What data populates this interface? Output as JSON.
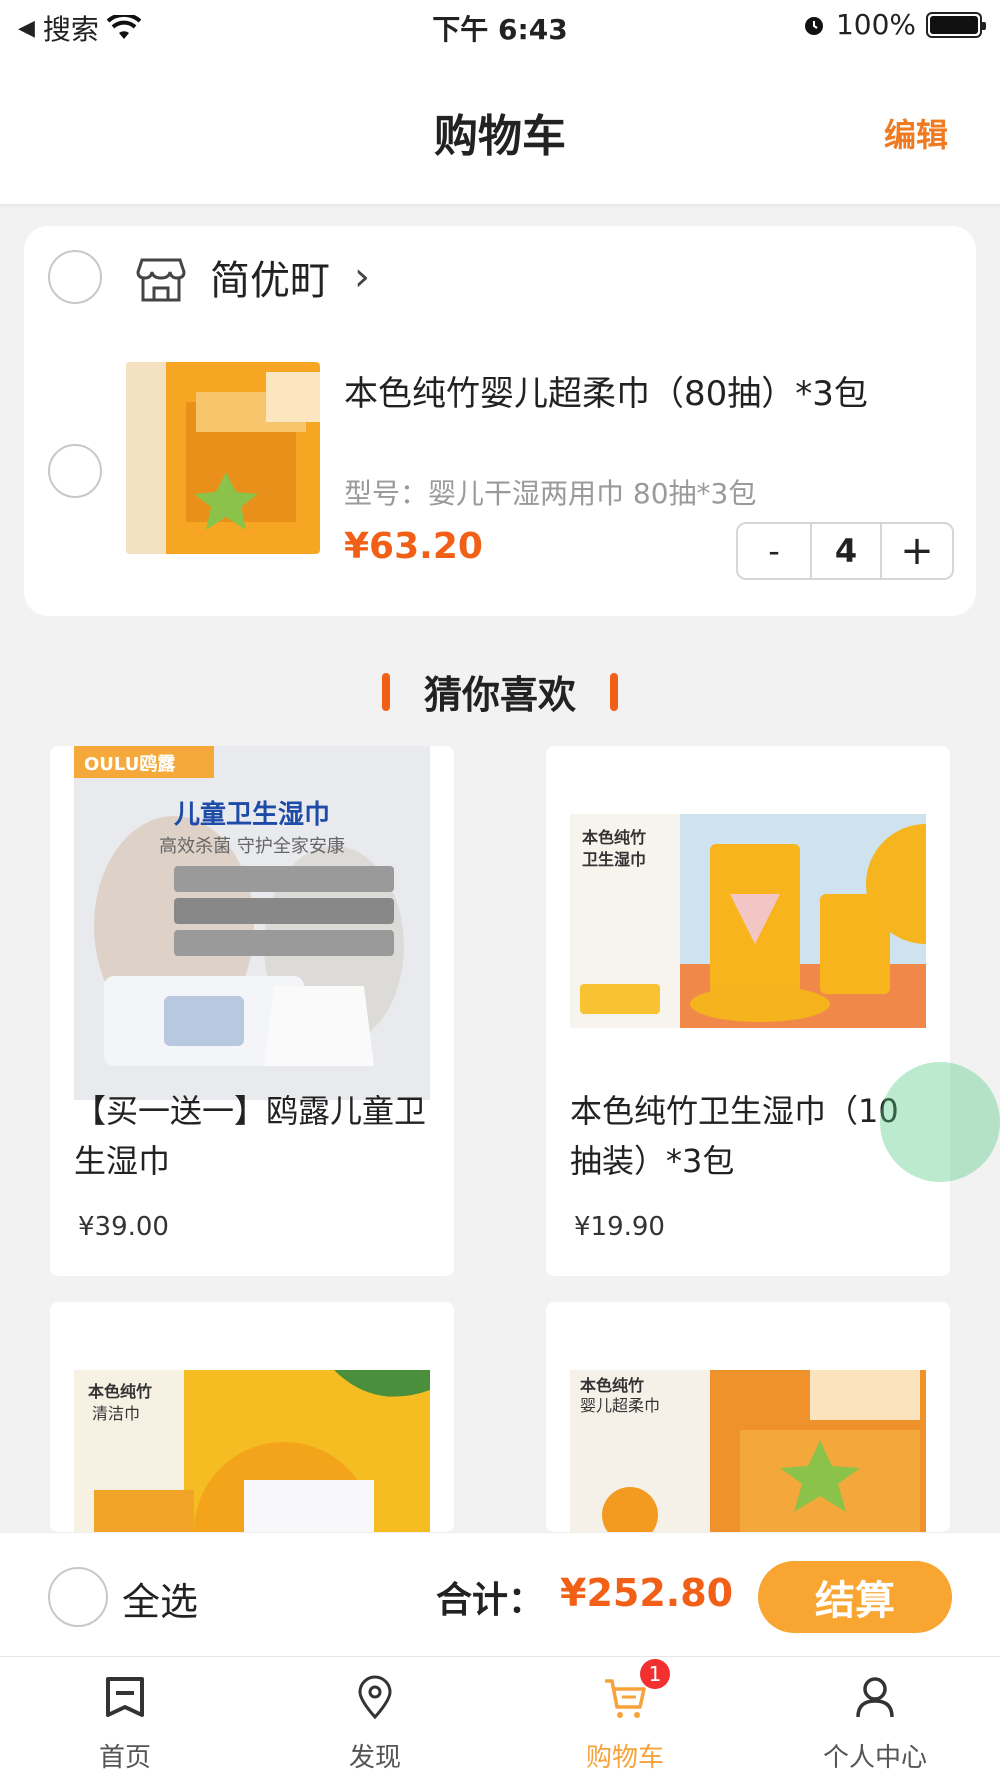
{
  "status_bar": {
    "back_label": "搜索",
    "time": "下午 6:43",
    "battery": "100%"
  },
  "header": {
    "title": "购物车",
    "edit": "编辑"
  },
  "cart": {
    "shop_name": "简优町",
    "item": {
      "title": "本色纯竹婴儿超柔巾（80抽）*3包",
      "spec": "型号：婴儿干湿两用巾 80抽*3包",
      "price": "¥63.20",
      "quantity": "4",
      "minus": "-",
      "plus": "+"
    }
  },
  "recommend": {
    "title": "猜你喜欢",
    "products": [
      {
        "title": "【买一送一】鸥露儿童卫生湿巾",
        "price": "¥39.00",
        "image_text": "儿童卫生湿巾",
        "image_sub": "高效杀菌 守护全家安康",
        "brand": "OULU鸥露"
      },
      {
        "title": "本色纯竹卫生湿巾（10抽装）*3包",
        "price": "¥19.90",
        "image_text": "本色纯竹",
        "image_sub": "卫生湿巾"
      },
      {
        "title": "",
        "price": "",
        "image_text": "本色纯竹",
        "image_sub": "清洁巾"
      },
      {
        "title": "",
        "price": "",
        "image_text": "本色纯竹",
        "image_sub": "婴儿超柔巾"
      }
    ]
  },
  "action_bar": {
    "select_all": "全选",
    "total_label": "合计：",
    "total_value": "¥252.80",
    "checkout": "结算"
  },
  "tabs": [
    {
      "label": "首页",
      "icon": "home-icon"
    },
    {
      "label": "发现",
      "icon": "location-icon"
    },
    {
      "label": "购物车",
      "icon": "cart-icon",
      "badge": "1"
    },
    {
      "label": "个人中心",
      "icon": "user-icon"
    }
  ],
  "colors": {
    "accent": "#f25f17",
    "checkout": "#f8a531",
    "active_tab": "#f7a23a"
  }
}
